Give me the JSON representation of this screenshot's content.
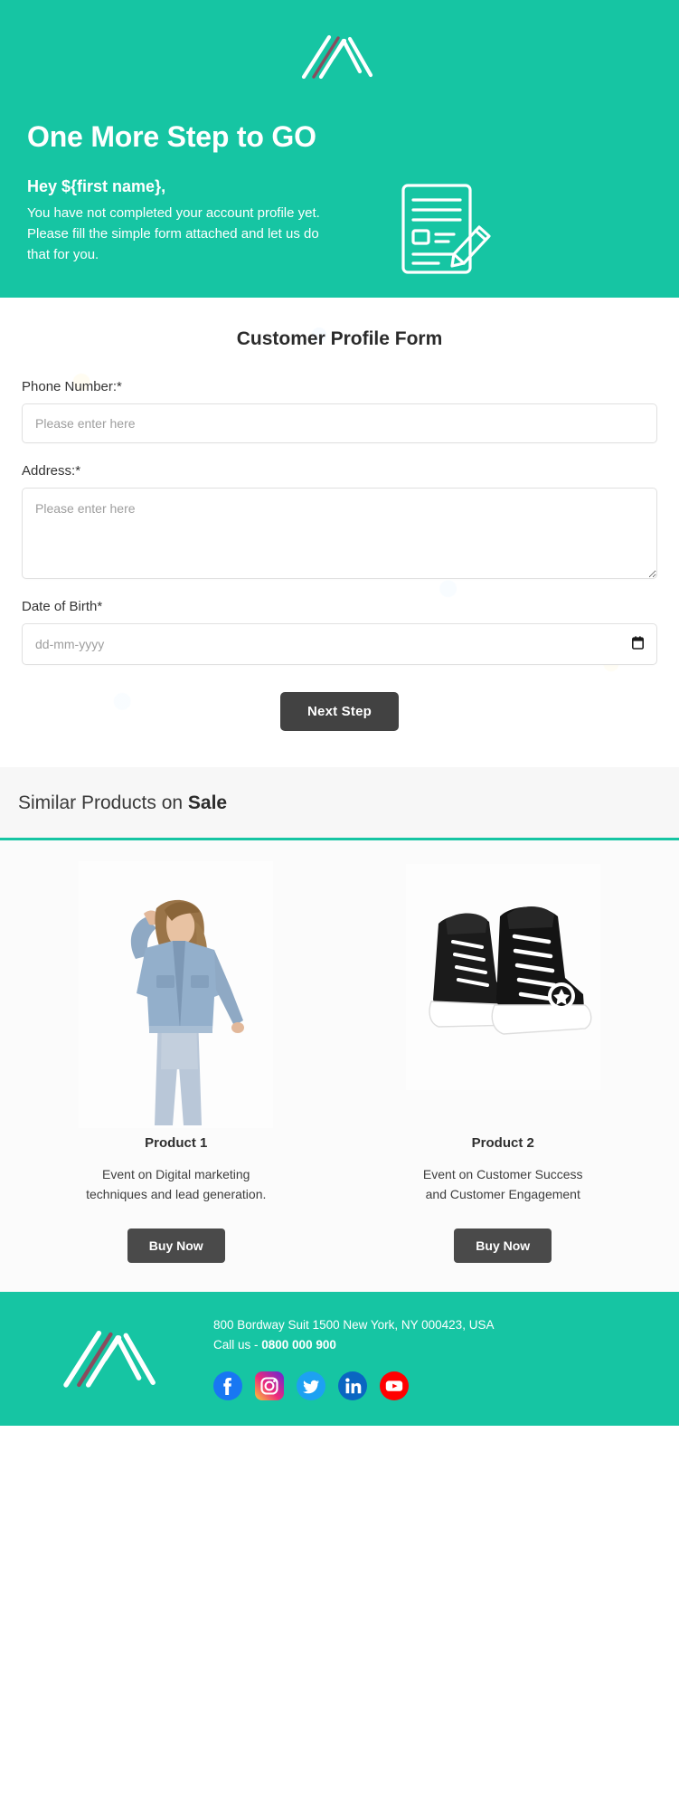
{
  "brand": {
    "accent_color": "#16c5a3",
    "logo_stroke_color": "#ffffff",
    "logo_accent_stroke_color": "#8a4b5e",
    "dark_button_color": "#424242"
  },
  "hero": {
    "logo_name": "company-logo-mark",
    "title": "One More Step to GO",
    "greeting": "Hey ${first name},",
    "body_line_1": "You have not completed your account profile yet.",
    "body_line_2": "Please fill the simple form attached and let us do",
    "body_line_3": "that for you.",
    "illustration_name": "form-with-pencil-icon"
  },
  "form": {
    "heading": "Customer Profile Form",
    "fields": [
      {
        "label": "Phone Number:*",
        "placeholder": "Please enter here",
        "type": "text",
        "name": "phone-number"
      },
      {
        "label": "Address:*",
        "placeholder": "Please enter here",
        "type": "textarea",
        "name": "address"
      },
      {
        "label": "Date of Birth*",
        "placeholder": "dd-mm-yyyy",
        "type": "date",
        "name": "date-of-birth"
      }
    ],
    "submit_label": "Next Step"
  },
  "products": {
    "heading_normal": "Similar Products on ",
    "heading_bold": "Sale",
    "items": [
      {
        "title": "Product 1",
        "description_line_1": "Event on Digital marketing",
        "description_line_2": "techniques and lead generation.",
        "button_label": "Buy Now",
        "image_name": "woman-in-denim-jacket-photo"
      },
      {
        "title": "Product 2",
        "description_line_1": "Event on Customer Success",
        "description_line_2": "and Customer Engagement",
        "button_label": "Buy Now",
        "image_name": "black-high-top-sneakers-photo"
      }
    ]
  },
  "footer": {
    "logo_name": "company-logo-mark",
    "address": "800 Bordway Suit 1500 New York, NY 000423, USA",
    "call_prefix": "Call us - ",
    "phone": "0800 000 900",
    "social": [
      {
        "name": "facebook-icon",
        "label": "Facebook",
        "color": "#3b5998"
      },
      {
        "name": "instagram-icon",
        "label": "Instagram",
        "color": "#e1306c"
      },
      {
        "name": "twitter-icon",
        "label": "Twitter",
        "color": "#1da1f2"
      },
      {
        "name": "linkedin-icon",
        "label": "LinkedIn",
        "color": "#0a66c2"
      },
      {
        "name": "youtube-icon",
        "label": "YouTube",
        "color": "#ff0000"
      }
    ]
  }
}
